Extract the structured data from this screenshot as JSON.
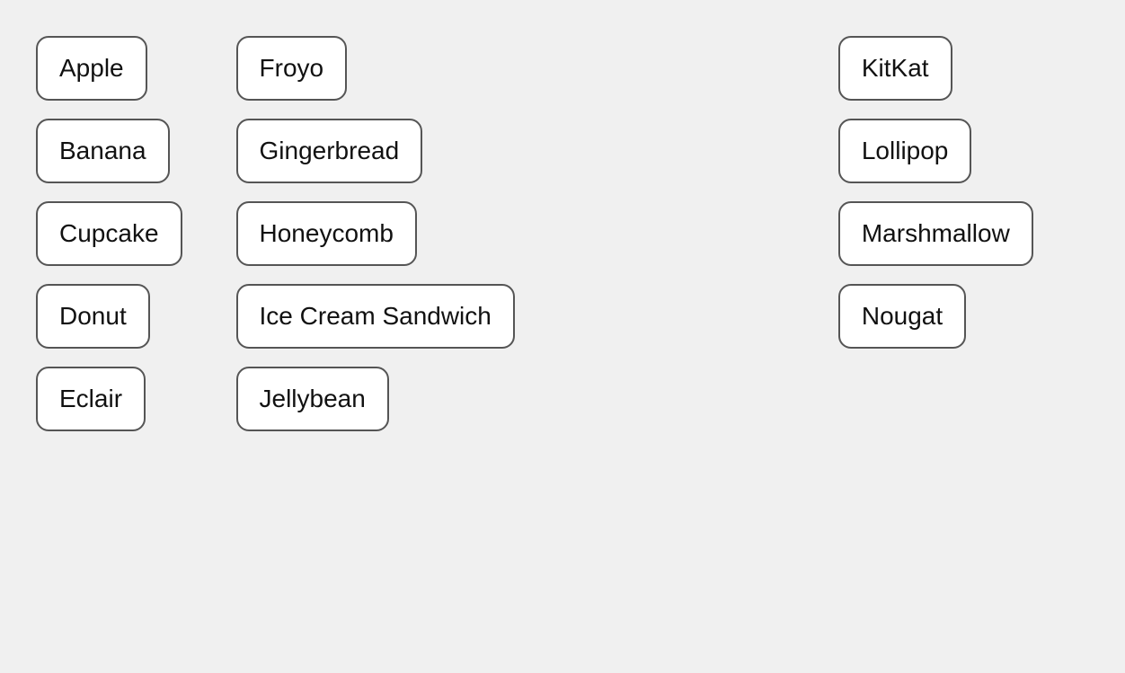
{
  "columns": {
    "col1": {
      "items": [
        {
          "label": "Apple"
        },
        {
          "label": "Banana"
        },
        {
          "label": "Cupcake"
        },
        {
          "label": "Donut"
        },
        {
          "label": "Eclair"
        }
      ]
    },
    "col2": {
      "items": [
        {
          "label": "Froyo"
        },
        {
          "label": "Gingerbread"
        },
        {
          "label": "Honeycomb"
        },
        {
          "label": "Ice Cream Sandwich"
        },
        {
          "label": "Jellybean"
        }
      ]
    },
    "col3": {
      "items": [
        {
          "label": "KitKat"
        },
        {
          "label": "Lollipop"
        },
        {
          "label": "Marshmallow"
        },
        {
          "label": "Nougat"
        }
      ]
    }
  }
}
